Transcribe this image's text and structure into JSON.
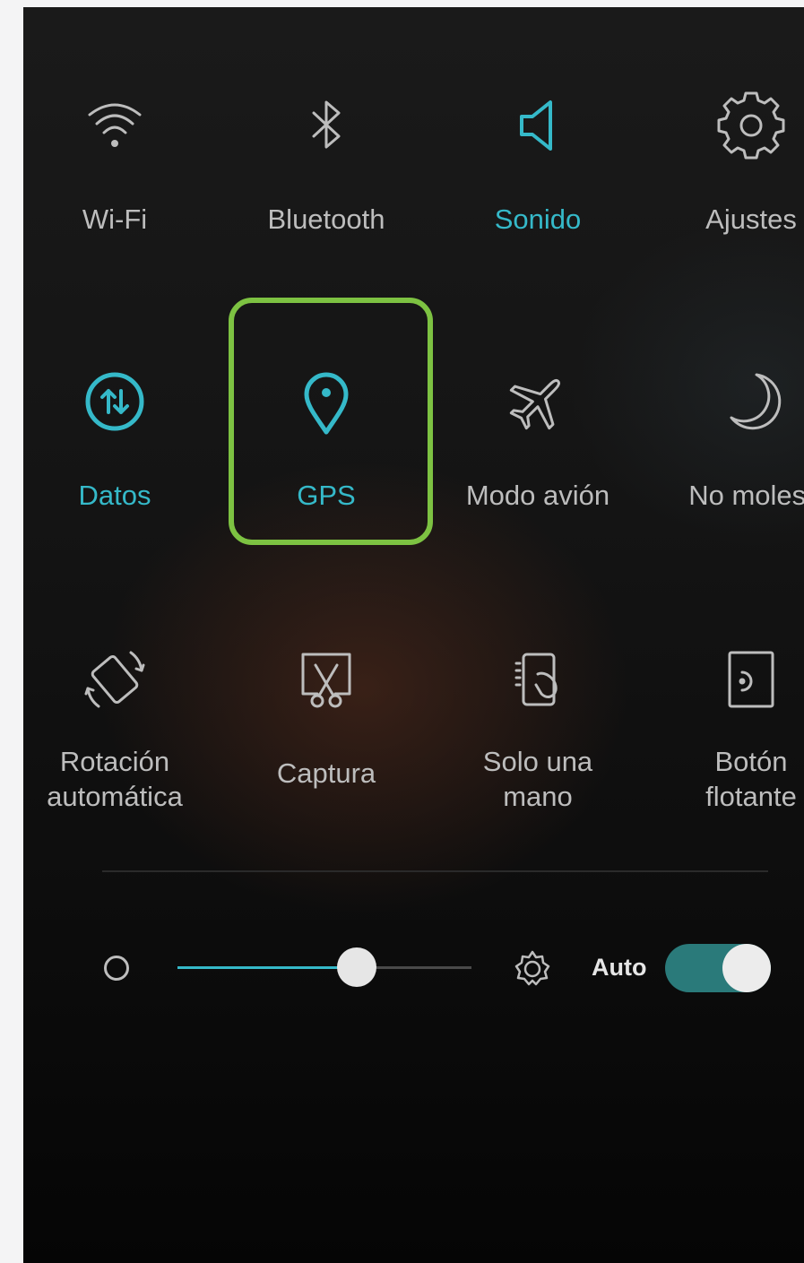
{
  "colors": {
    "accent": "#35b9c9",
    "inactive": "#bdbdbd",
    "highlight_border": "#7dc242",
    "toggle_on": "#2a7a7a"
  },
  "tiles": {
    "wifi": {
      "label": "Wi-Fi",
      "icon": "wifi-icon",
      "active": false
    },
    "bluetooth": {
      "label": "Bluetooth",
      "icon": "bluetooth-icon",
      "active": false
    },
    "sound": {
      "label": "Sonido",
      "icon": "speaker-icon",
      "active": true
    },
    "settings": {
      "label": "Ajustes",
      "icon": "gear-icon",
      "active": false
    },
    "data": {
      "label": "Datos",
      "icon": "mobile-data-icon",
      "active": true
    },
    "gps": {
      "label": "GPS",
      "icon": "location-pin-icon",
      "active": true,
      "highlighted": true
    },
    "airplane": {
      "label": "Modo avión",
      "icon": "airplane-icon",
      "active": false
    },
    "dnd": {
      "label": "No molest",
      "icon": "moon-icon",
      "active": false
    },
    "rotation": {
      "label": "Rotación\nautomática",
      "icon": "rotation-icon",
      "active": false
    },
    "screenshot": {
      "label": "Captura",
      "icon": "screenshot-scissors-icon",
      "active": false
    },
    "one_hand": {
      "label": "Solo una\nmano",
      "icon": "one-hand-icon",
      "active": false
    },
    "float_button": {
      "label": "Botón\nflotante",
      "icon": "floating-button-icon",
      "active": false
    }
  },
  "brightness": {
    "level": 0.61,
    "auto_label": "Auto",
    "auto_enabled": true
  }
}
